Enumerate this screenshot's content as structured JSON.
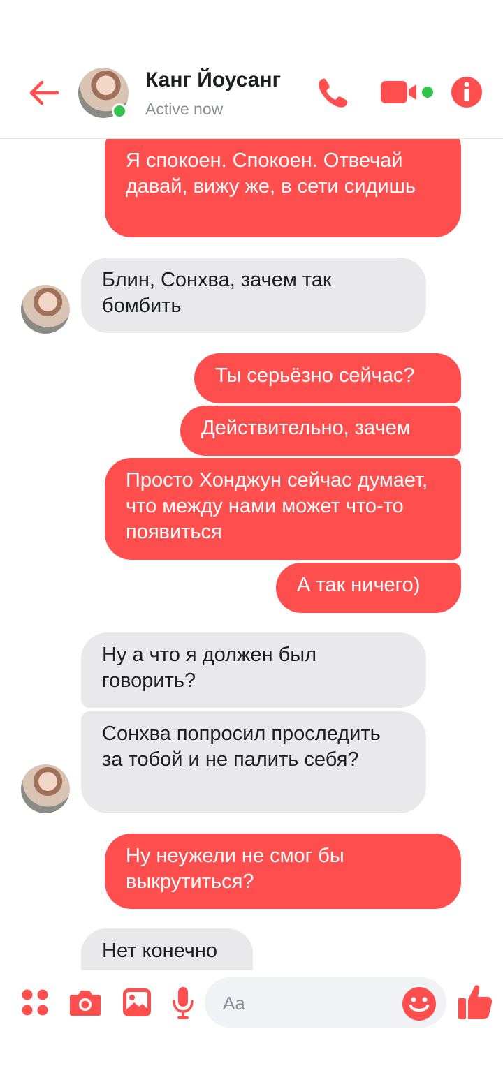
{
  "header": {
    "contact_name": "Канг Йоусанг",
    "status": "Active now",
    "accent_color": "#ff4e4e",
    "online_color": "#31c24a",
    "icons": [
      "back-arrow-icon",
      "phone-icon",
      "video-camera-icon",
      "info-icon"
    ]
  },
  "messages": [
    {
      "direction": "outgoing",
      "text": "Я спокоен. Спокоен. Отвечай давай, вижу же, в сети сидишь"
    },
    {
      "direction": "incoming",
      "text": "Блин, Сонхва, зачем так бомбить"
    },
    {
      "direction": "outgoing",
      "text": "Ты серьёзно сейчас?"
    },
    {
      "direction": "outgoing",
      "text": "Действительно, зачем"
    },
    {
      "direction": "outgoing",
      "text": "Просто Хонджун сейчас думает, что между нами может что-то появиться"
    },
    {
      "direction": "outgoing",
      "text": "А так ничего)"
    },
    {
      "direction": "incoming",
      "text": "Ну а что я должен был говорить?"
    },
    {
      "direction": "incoming",
      "text": "Сонхва попросил проследить за тобой и не палить себя?"
    },
    {
      "direction": "outgoing",
      "text": "Ну неужели не смог бы выкрутиться?"
    },
    {
      "direction": "incoming",
      "text": "Нет конечно"
    }
  ],
  "composer": {
    "placeholder": "Aa",
    "icons": [
      "apps-icon",
      "camera-icon",
      "gallery-icon",
      "microphone-icon",
      "emoji-icon",
      "thumbs-up-icon"
    ]
  },
  "colors": {
    "outgoing_bubble": "#ff4e4e",
    "incoming_bubble": "#e9e9eb"
  }
}
